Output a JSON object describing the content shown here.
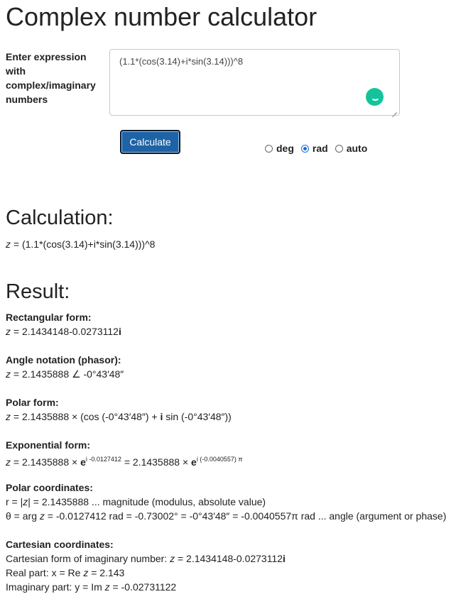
{
  "title": "Complex number calculator",
  "form": {
    "label": "Enter expression with complex/imaginary numbers",
    "expression": "(1.1*(cos(3.14)+i*sin(3.14)))^8",
    "calculate_label": "Calculate",
    "angle_modes": [
      {
        "label": "deg",
        "checked": false
      },
      {
        "label": "rad",
        "checked": true
      },
      {
        "label": "auto",
        "checked": false
      }
    ]
  },
  "calculation": {
    "heading": "Calculation:",
    "z": "z",
    "expr": " = (1.1*(cos(3.14)+i*sin(3.14)))^8"
  },
  "result": {
    "heading": "Result:",
    "rectangular": {
      "heading": "Rectangular form:",
      "z": "z",
      "value": " = 2.1434148-0.0273112",
      "i": "i"
    },
    "angle": {
      "heading": "Angle notation (phasor):",
      "z": "z",
      "value": " = 2.1435888 ∠ -0°43′48″"
    },
    "polar": {
      "heading": "Polar form:",
      "z": "z",
      "pre": " = 2.1435888 × (cos (-0°43′48″) + ",
      "i": "i",
      "post": " sin (-0°43′48″))"
    },
    "exponential": {
      "heading": "Exponential form:",
      "z": "z",
      "pre": " = 2.1435888 × ",
      "e1": "e",
      "sup1": "i -0.0127412",
      "mid": " = 2.1435888 × ",
      "e2": "e",
      "sup2": "i (-0.0040557) π"
    },
    "polar_coords": {
      "heading": "Polar coordinates:",
      "r_pre": "r = |",
      "r_z": "z",
      "r_post": "| = 2.1435888 ... magnitude (modulus, absolute value)",
      "theta_pre": "θ = arg ",
      "theta_z": "z",
      "theta_post": " = -0.0127412 rad = -0.73002° = -0°43′48″ = -0.0040557π rad ... angle (argument or phase)"
    },
    "cartesian": {
      "heading": "Cartesian coordinates:",
      "form_pre": "Cartesian form of imaginary number: ",
      "form_z": "z",
      "form_value": " = 2.1434148-0.0273112",
      "form_i": "i",
      "real_pre": "Real part: x = Re ",
      "real_z": "z",
      "real_value": " = 2.143",
      "imag_pre": "Imaginary part: y = Im ",
      "imag_z": "z",
      "imag_value": " = -0.02731122"
    }
  }
}
